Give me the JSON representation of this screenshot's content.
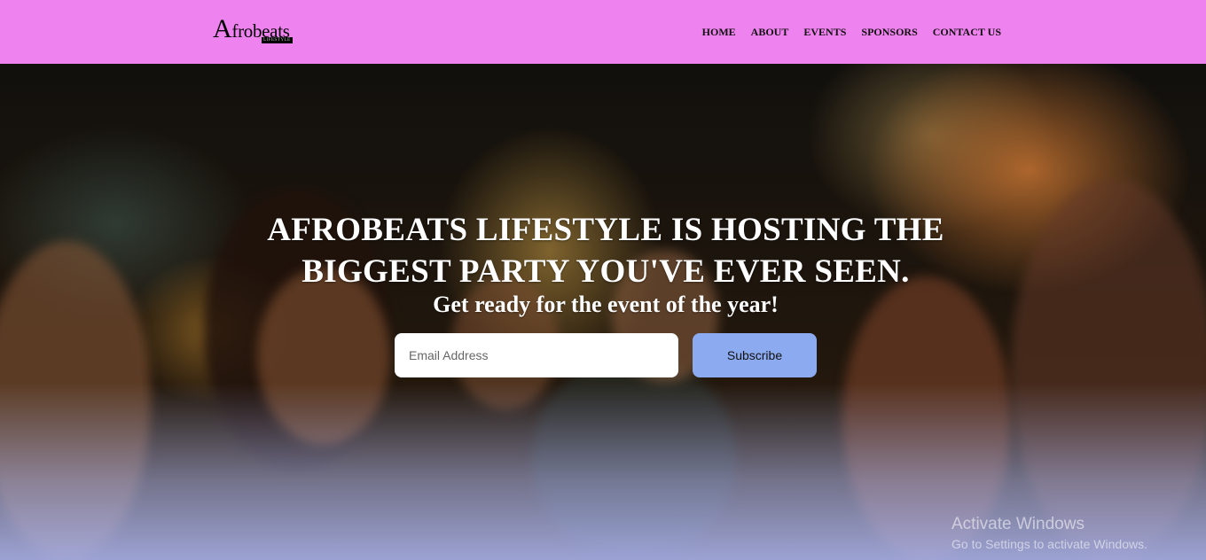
{
  "header": {
    "logo_text_initial": "A",
    "logo_text_rest": "frobeats",
    "logo_sub": "LIFESTYLE"
  },
  "nav": {
    "items": [
      {
        "label": "HOME"
      },
      {
        "label": "ABOUT"
      },
      {
        "label": "EVENTS"
      },
      {
        "label": "SPONSORS"
      },
      {
        "label": "CONTACT US"
      }
    ]
  },
  "hero": {
    "headline_line1": "AFROBEATS LIFESTYLE IS HOSTING THE",
    "headline_line2": "BIGGEST PARTY YOU'VE EVER SEEN.",
    "subheadline": "Get ready for the event of the year!",
    "email_placeholder": "Email Address",
    "subscribe_label": "Subscribe"
  },
  "watermark": {
    "line1": "Activate Windows",
    "line2": "Go to Settings to activate Windows."
  },
  "colors": {
    "navbar_bg": "#ee82ee",
    "subscribe_bg": "#8caaf0",
    "headline": "#ffffff"
  }
}
